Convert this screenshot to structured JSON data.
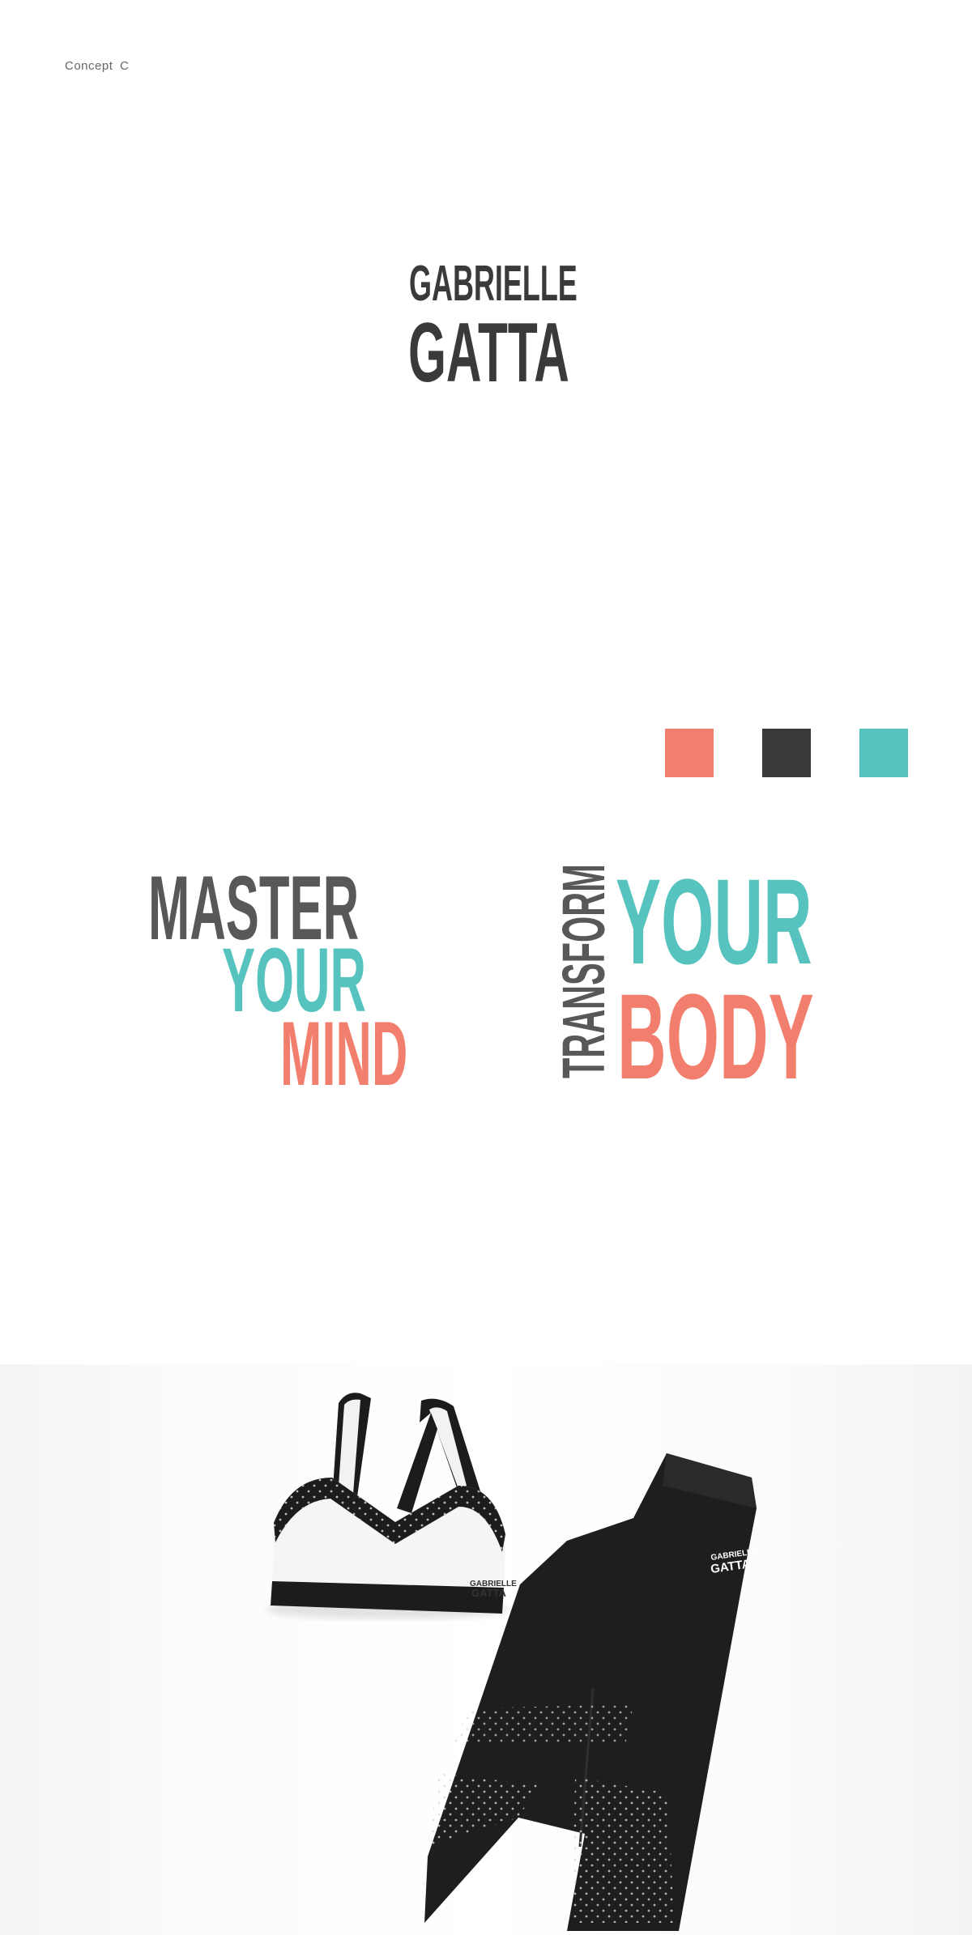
{
  "concept_label": "Concept  C",
  "logo": {
    "line1": "GABRIELLE",
    "line2": "GATTA"
  },
  "palette": {
    "coral": "#f27f6e",
    "charcoal": "#3a3a3c",
    "teal": "#57c3bf"
  },
  "slogan_left": {
    "line1": "MASTER",
    "line2": "YOUR",
    "line3": "MIND"
  },
  "slogan_right": {
    "vertical": "TRANSFORM",
    "line1": "YOUR",
    "line2": "BODY"
  },
  "product_photo": {
    "bra_label_line1": "GABRIELLE",
    "bra_label_line2": "GATTA",
    "leggings_label_line1": "GABRIELLE",
    "leggings_label_line2": "GATTA"
  }
}
